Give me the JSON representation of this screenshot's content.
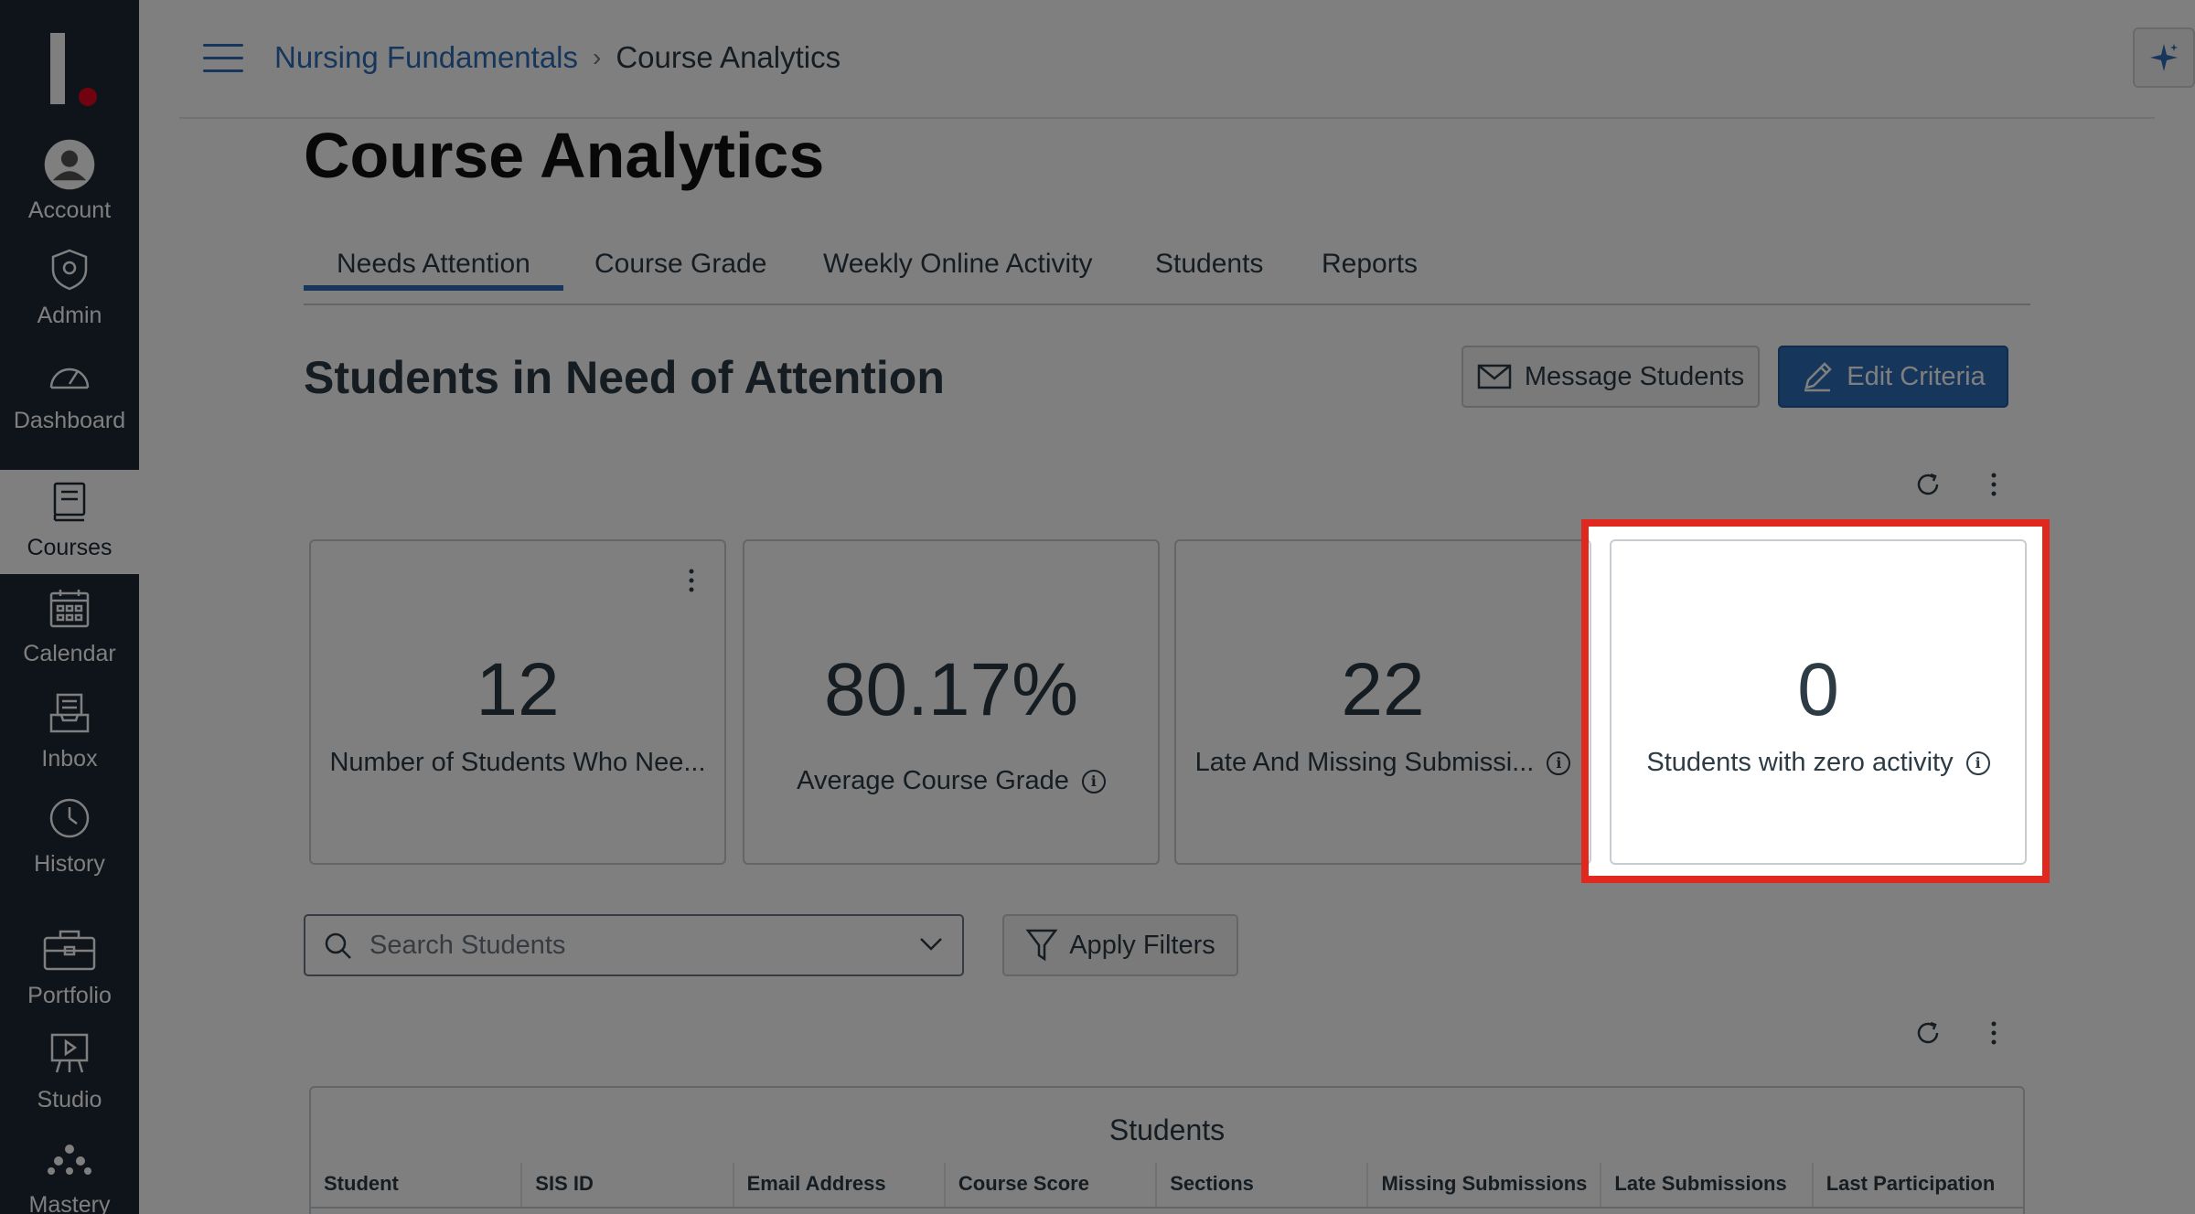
{
  "sidebar": {
    "items": [
      {
        "label": "Account",
        "icon": "account-icon"
      },
      {
        "label": "Admin",
        "icon": "admin-icon"
      },
      {
        "label": "Dashboard",
        "icon": "dashboard-icon"
      },
      {
        "label": "Courses",
        "icon": "courses-icon",
        "active": true
      },
      {
        "label": "Calendar",
        "icon": "calendar-icon"
      },
      {
        "label": "Inbox",
        "icon": "inbox-icon"
      },
      {
        "label": "History",
        "icon": "history-icon"
      },
      {
        "label": "Portfolio",
        "icon": "portfolio-icon"
      },
      {
        "label": "Studio",
        "icon": "studio-icon"
      },
      {
        "label": "Mastery",
        "icon": "mastery-icon"
      }
    ]
  },
  "header": {
    "breadcrumb": [
      "Nursing Fundamentals",
      "Course Analytics"
    ],
    "separator": "›"
  },
  "page": {
    "title": "Course Analytics",
    "tabs": [
      "Needs Attention",
      "Course Grade",
      "Weekly Online Activity",
      "Students",
      "Reports"
    ],
    "active_tab": "Needs Attention"
  },
  "section": {
    "title": "Students in Need of Attention",
    "message_button": "Message Students",
    "edit_button": "Edit Criteria"
  },
  "cards": [
    {
      "value": "12",
      "label": "Number of Students Who Nee..."
    },
    {
      "value": "80.17%",
      "label": "Average Course Grade"
    },
    {
      "value": "22",
      "label": "Late And Missing Submissi..."
    },
    {
      "value": "0",
      "label": "Students with zero activity"
    }
  ],
  "filters": {
    "search_placeholder": "Search Students",
    "apply_button": "Apply Filters"
  },
  "table": {
    "caption": "Students",
    "columns": [
      "Student",
      "SIS ID",
      "Email Address",
      "Course Score",
      "Sections",
      "Missing Submissions",
      "Late Submissions",
      "Last Participation"
    ]
  },
  "colors": {
    "sidebar": "#1f2937",
    "accent": "#2d6cb7",
    "highlight": "#e0281f"
  }
}
